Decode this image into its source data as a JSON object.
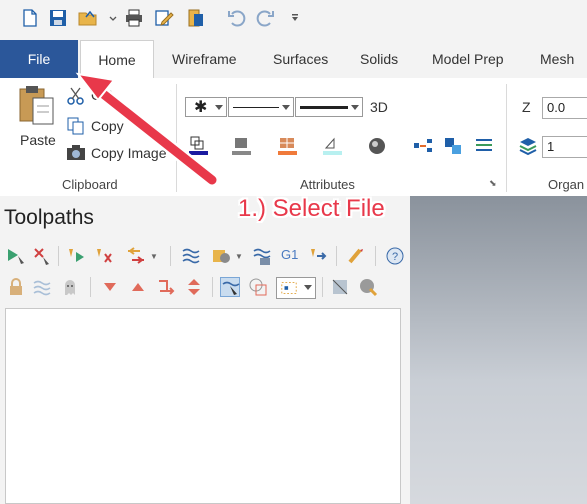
{
  "quick_access": {
    "icons": [
      "new-file-icon",
      "save-icon",
      "open-folder-icon",
      "print-icon",
      "edit-icon",
      "file-manager-icon",
      "undo-icon",
      "redo-icon",
      "customize-icon"
    ]
  },
  "tabs": {
    "file": "File",
    "home": "Home",
    "wireframe": "Wireframe",
    "surfaces": "Surfaces",
    "solids": "Solids",
    "model_prep": "Model Prep",
    "mesh": "Mesh"
  },
  "clipboard": {
    "paste": "Paste",
    "cut": "Cut",
    "copy": "Copy",
    "copy_image": "Copy Image",
    "group_label": "Clipboard"
  },
  "attributes": {
    "mode_3d": "3D",
    "group_label": "Attributes"
  },
  "organize": {
    "z_label": "Z",
    "z_value": "0.0",
    "level_value": "1",
    "group_label": "Organ"
  },
  "toolpaths": {
    "title": "Toolpaths",
    "g1_label": "G1"
  },
  "annotation": {
    "text": "1.) Select File",
    "color": "#e8384a"
  }
}
